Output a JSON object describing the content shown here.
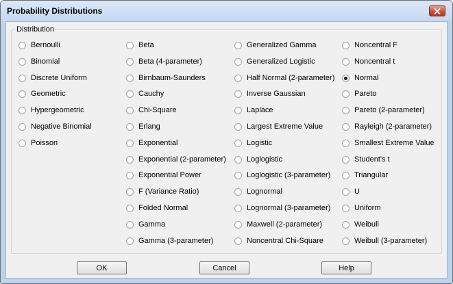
{
  "window": {
    "title": "Probability Distributions"
  },
  "group": {
    "label": "Distribution"
  },
  "columns": [
    [
      "Bernoulli",
      "Binomial",
      "Discrete Uniform",
      "Geometric",
      "Hypergeometric",
      "Negative Binomial",
      "Poisson"
    ],
    [
      "Beta",
      "Beta (4-parameter)",
      "Birnbaum-Saunders",
      "Cauchy",
      "Chi-Square",
      "Erlang",
      "Exponential",
      "Exponential (2-parameter)",
      "Exponential Power",
      "F (Variance Ratio)",
      "Folded Normal",
      "Gamma",
      "Gamma (3-parameter)"
    ],
    [
      "Generalized Gamma",
      "Generalized Logistic",
      "Half Normal (2-parameter)",
      "Inverse Gaussian",
      "Laplace",
      "Largest Extreme Value",
      "Logistic",
      "Loglogistic",
      "Loglogistic (3-parameter)",
      "Lognormal",
      "Lognormal (3-parameter)",
      "Maxwell (2-parameter)",
      "Noncentral Chi-Square"
    ],
    [
      "Noncentral F",
      "Noncentral t",
      "Normal",
      "Pareto",
      "Pareto (2-parameter)",
      "Rayleigh (2-parameter)",
      "Smallest Extreme Value",
      "Student's t",
      "Triangular",
      "U",
      "Uniform",
      "Weibull",
      "Weibull (3-parameter)"
    ]
  ],
  "selected": "Normal",
  "buttons": {
    "ok": "OK",
    "cancel": "Cancel",
    "help": "Help"
  },
  "icons": {
    "close": "close-icon"
  },
  "colors": {
    "close_button": "#c8523e",
    "frame": "#bcd3ee"
  }
}
